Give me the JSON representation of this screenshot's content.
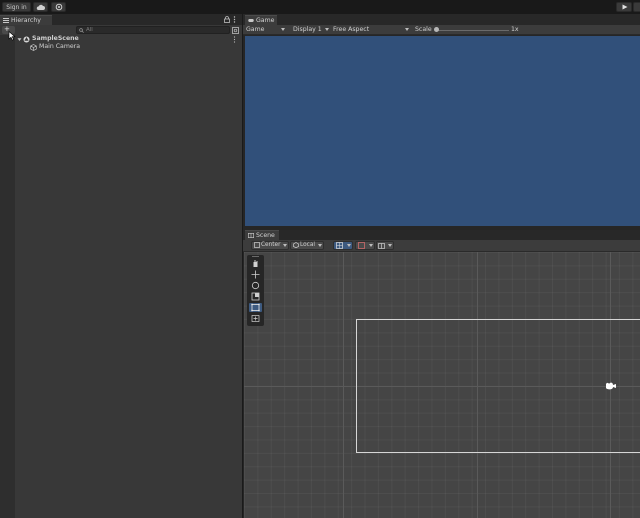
{
  "toolbar": {
    "sign_in": "Sign in",
    "cloud_icon": "cloud-icon",
    "services_icon": "settings-circle-icon",
    "play_icon": "play-icon"
  },
  "hierarchy": {
    "tab_label": "Hierarchy",
    "add_label": "+",
    "search_placeholder": "All",
    "lock_icon": "lock-icon",
    "menu_icon": "kebab-menu-icon",
    "items": [
      {
        "label": "SampleScene",
        "icon": "unity-scene-icon"
      },
      {
        "label": "Main Camera",
        "icon": "cube-icon"
      }
    ]
  },
  "game": {
    "tab_label": "Game",
    "mode": "Game",
    "display": "Display 1",
    "aspect": "Free Aspect",
    "scale_label": "Scale",
    "scale_value": 1,
    "scale_value_label": "1x",
    "view_color": "#31507a"
  },
  "scene": {
    "tab_label": "Scene",
    "pivot": "Center",
    "space": "Local",
    "tools": [
      "view-hand-tool",
      "move-tool",
      "rotate-tool",
      "scale-tool",
      "rect-tool",
      "transform-tool"
    ],
    "active_tool": "rect-tool",
    "grid_color": "#454545"
  },
  "colors": {
    "accent": "#4a6ea0",
    "panel": "#383838",
    "toolbar": "#191919"
  }
}
